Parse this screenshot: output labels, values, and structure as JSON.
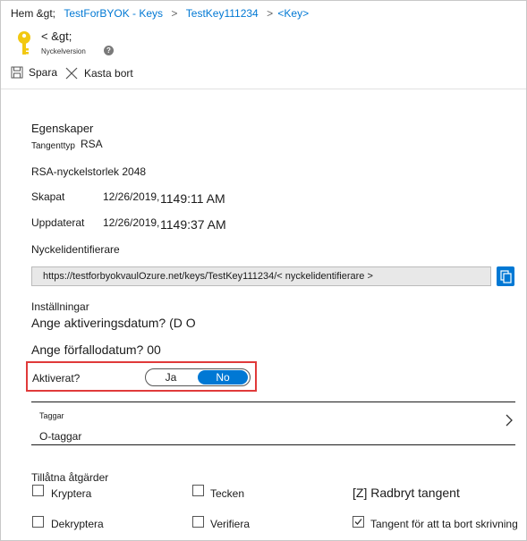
{
  "breadcrumb": {
    "home": "Hem &gt;",
    "item1": "TestForBYOK - Keys",
    "item2": "TestKey111234",
    "item3": "<Key>",
    "sep": ">"
  },
  "header": {
    "title": "< &gt;",
    "subtitle": "Nyckelversion",
    "help": "?"
  },
  "toolbar": {
    "save_label": "Spara",
    "discard_label": "Kasta bort"
  },
  "properties": {
    "heading": "Egenskaper",
    "key_type_label": "Tangenttyp",
    "key_type_value": "RSA",
    "rsa_size": "RSA-nyckelstorlek 2048",
    "created_label": "Skapat",
    "created_date": "12/26/2019,",
    "created_time": "1149:11 AM",
    "updated_label": "Uppdaterat",
    "updated_date": "12/26/2019,",
    "updated_time": "1149:37 AM",
    "key_id_label": "Nyckelidentifierare",
    "key_id_value": "https://testforbyokvaulOzure.net/keys/TestKey111234/< nyckelidentifierare >"
  },
  "settings": {
    "heading": "Inställningar",
    "activation": "Ange aktiveringsdatum? (D O",
    "expiry": "Ange förfallodatum? 00",
    "enabled_label": "Aktiverat?",
    "toggle_yes": "Ja",
    "toggle_no": "No"
  },
  "tags": {
    "label": "Taggar",
    "value": "O-taggar"
  },
  "operations": {
    "heading": "Tillåtna åtgärder",
    "encrypt": "Kryptera",
    "sign": "Tecken",
    "wrap": "[Z] Radbryt tangent",
    "decrypt": "Dekryptera",
    "verify": "Verifiera",
    "unwrap": "Tangent för att ta bort skrivning"
  },
  "colors": {
    "accent": "#0078d4",
    "highlight": "#e03a3a",
    "key_icon": "#f2c811"
  }
}
